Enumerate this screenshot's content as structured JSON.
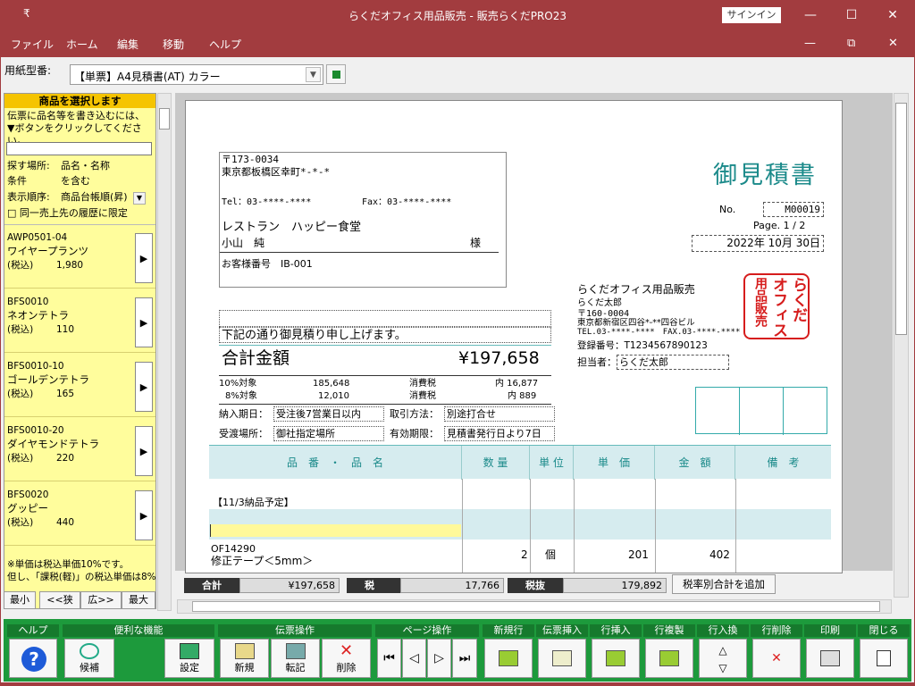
{
  "window": {
    "title": "らくだオフィス用品販売 - 販売らくだPRO23",
    "signin": "サインイン",
    "min": "—",
    "max": "☐",
    "close": "✕",
    "restore": "⧉",
    "menu_mark": "₹"
  },
  "menu": [
    "ファイル",
    "ホーム",
    "編集",
    "移動",
    "ヘルプ"
  ],
  "form": {
    "label": "用紙型番:",
    "value": "【単票】A4見積書(AT) カラー"
  },
  "left": {
    "header": "商品を選択します",
    "hint1": "伝票に品名等を書き込むには、",
    "hint2": "▼ボタンをクリックしてください。",
    "search_value": "",
    "search_place_label": "探す場所:",
    "search_place": "品名・名称",
    "cond_label": "条件",
    "cond": "を含む",
    "order_label": "表示順序:",
    "order": "商品台帳順(昇)",
    "history_label": "□ 同一売上先の履歴に限定",
    "items": [
      {
        "code": "AWP0501-04",
        "name": "ワイヤープランツ",
        "tax": "(税込)",
        "price": "1,980"
      },
      {
        "code": "BFS0010",
        "name": "ネオンテトラ",
        "tax": "(税込)",
        "price": "110"
      },
      {
        "code": "BFS0010-10",
        "name": "ゴールデンテトラ",
        "tax": "(税込)",
        "price": "165"
      },
      {
        "code": "BFS0010-20",
        "name": "ダイヤモンドテトラ",
        "tax": "(税込)",
        "price": "220"
      },
      {
        "code": "BFS0020",
        "name": "グッピー",
        "tax": "(税込)",
        "price": "440"
      }
    ],
    "note1": "※単価は税込単価10%です。",
    "note2": "但し、「課税(軽)」の税込単価は8%",
    "nav": [
      "最小",
      "<<狭",
      "広>>",
      "最大"
    ]
  },
  "doc": {
    "zip": "〒173-0034",
    "addr": "東京都板橋区幸町*-*-*",
    "tel": "Tel：03-****-****",
    "fax": "Fax：03-****-****",
    "cust": "レストラン　ハッピー食堂",
    "person": "小山　純",
    "sama": "様",
    "custno": "お客様番号　IB-001",
    "title": "御見積書",
    "no_label": "No.",
    "no": "M00019",
    "page": "Page. 1 / 2",
    "date": "2022年 10月 30日",
    "company": "らくだオフィス用品販売",
    "rep": "らくだ太郎",
    "czip": "〒160-0004",
    "caddr": "東京都新宿区四谷*-**四谷ビル",
    "ctel": "TEL.03-****-****　FAX.03-****-****",
    "regno": "登録番号：T1234567890123",
    "staff_label": "担当者：",
    "staff": "らくだ太郎",
    "seal": [
      "らくだ",
      "オフィス",
      "用品販売"
    ],
    "lead": "下記の通り御見積り申し上げます。",
    "sum_label": "合計金額",
    "sum": "¥197,658",
    "r10": "10%対象",
    "r10v": "185,648",
    "t10": "消費税",
    "t10v": "内 16,877",
    "r8": "8%対象",
    "r8v": "12,010",
    "t8": "消費税",
    "t8v": "内 889",
    "deliv_label": "納入期日：",
    "deliv": "受注後7営業日以内",
    "trade_label": "取引方法：",
    "trade": "別途打合せ",
    "place_label": "受渡場所：",
    "place": "御社指定場所",
    "valid_label": "有効期限：",
    "valid": "見積書発行日より7日",
    "cols": [
      "品　番　・　品　名",
      "数 量",
      "単 位",
      "単　価",
      "金　額",
      "備　考"
    ],
    "row1": "【11/3納品予定】",
    "r3code": "OF14290",
    "r3name": "修正テープ＜5mm＞",
    "r3qty": "2",
    "r3unit": "個",
    "r3price": "201",
    "r3amt": "402"
  },
  "status": {
    "total_label": "合計",
    "total": "¥197,658",
    "tax_label": "税",
    "tax": "17,766",
    "ex_label": "税抜",
    "ex": "179,892",
    "taxbtn": "税率別合計を追加"
  },
  "toolbar": {
    "help": "ヘルプ",
    "convenient": "便利な機能",
    "candidate": "候補",
    "settings": "設定",
    "slip": "伝票操作",
    "new": "新規",
    "copy": "転記",
    "delete": "削除",
    "page": "ページ操作",
    "newline": "新規行",
    "insslip": "伝票挿入",
    "insrow": "行挿入",
    "duprow": "行複製",
    "swaprow": "行入換",
    "delrow": "行削除",
    "print": "印刷",
    "close": "閉じる"
  }
}
